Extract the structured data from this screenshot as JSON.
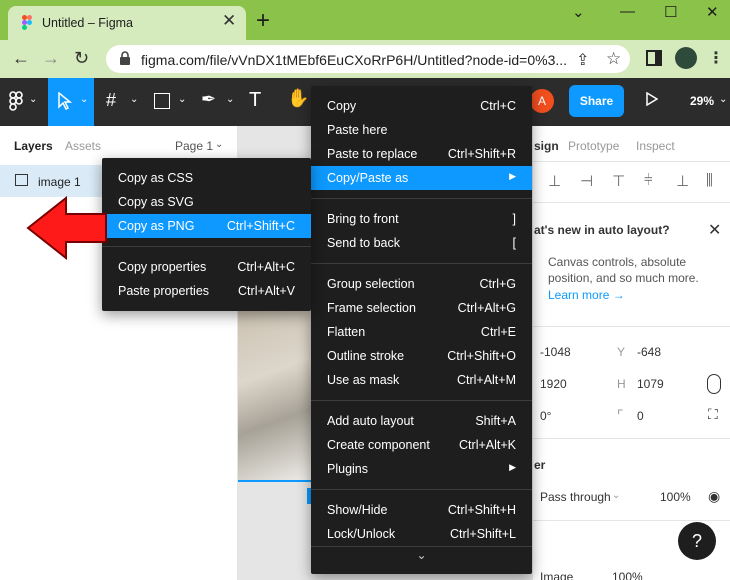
{
  "browser": {
    "tab_title": "Untitled – Figma",
    "url": "figma.com/file/vVnDX1tMEbf6EuCXoRrP6H/Untitled?node-id=0%3..."
  },
  "toolbar": {
    "share_label": "Share",
    "avatar_initial": "A",
    "zoom": "29%"
  },
  "left_panel": {
    "tabs": [
      "Layers",
      "Assets"
    ],
    "page_label": "Page 1",
    "layers": [
      {
        "name": "image 1"
      }
    ]
  },
  "right_panel": {
    "tabs": [
      "sign",
      "Prototype",
      "Inspect"
    ],
    "promo_title": "at's new in auto layout?",
    "promo_body": "Canvas controls, absolute position, and so much more.",
    "promo_link": "Learn more →",
    "x_label": "",
    "x_value": "-1048",
    "y_label": "Y",
    "y_value": "-648",
    "w_value": "1920",
    "h_label": "H",
    "h_value": "1079",
    "rotation": "0°",
    "radius": "0",
    "layer_header": "er",
    "blend_mode": "Pass through",
    "opacity": "100%",
    "fill_label": "Image",
    "fill_opacity": "100%",
    "help": "?"
  },
  "context_menu": {
    "groups": [
      [
        {
          "label": "Copy",
          "shortcut": "Ctrl+C"
        },
        {
          "label": "Paste here",
          "shortcut": ""
        },
        {
          "label": "Paste to replace",
          "shortcut": "Ctrl+Shift+R"
        },
        {
          "label": "Copy/Paste as",
          "shortcut": "▶",
          "highlighted": true
        }
      ],
      [
        {
          "label": "Bring to front",
          "shortcut": "]"
        },
        {
          "label": "Send to back",
          "shortcut": "["
        }
      ],
      [
        {
          "label": "Group selection",
          "shortcut": "Ctrl+G"
        },
        {
          "label": "Frame selection",
          "shortcut": "Ctrl+Alt+G"
        },
        {
          "label": "Flatten",
          "shortcut": "Ctrl+E"
        },
        {
          "label": "Outline stroke",
          "shortcut": "Ctrl+Shift+O"
        },
        {
          "label": "Use as mask",
          "shortcut": "Ctrl+Alt+M"
        }
      ],
      [
        {
          "label": "Add auto layout",
          "shortcut": "Shift+A"
        },
        {
          "label": "Create component",
          "shortcut": "Ctrl+Alt+K"
        },
        {
          "label": "Plugins",
          "shortcut": "▶"
        }
      ],
      [
        {
          "label": "Show/Hide",
          "shortcut": "Ctrl+Shift+H"
        },
        {
          "label": "Lock/Unlock",
          "shortcut": "Ctrl+Shift+L"
        }
      ]
    ],
    "more_glyph": "⌄"
  },
  "submenu": {
    "groups": [
      [
        {
          "label": "Copy as CSS",
          "shortcut": ""
        },
        {
          "label": "Copy as SVG",
          "shortcut": ""
        },
        {
          "label": "Copy as PNG",
          "shortcut": "Ctrl+Shift+C",
          "highlighted": true
        }
      ],
      [
        {
          "label": "Copy properties",
          "shortcut": "Ctrl+Alt+C"
        },
        {
          "label": "Paste properties",
          "shortcut": "Ctrl+Alt+V"
        }
      ]
    ]
  },
  "colors": {
    "accent": "#0d99ff",
    "menu_bg": "#1e1e1e",
    "browser_green": "#8bc34a",
    "arrow_red": "#ff1a1a"
  }
}
